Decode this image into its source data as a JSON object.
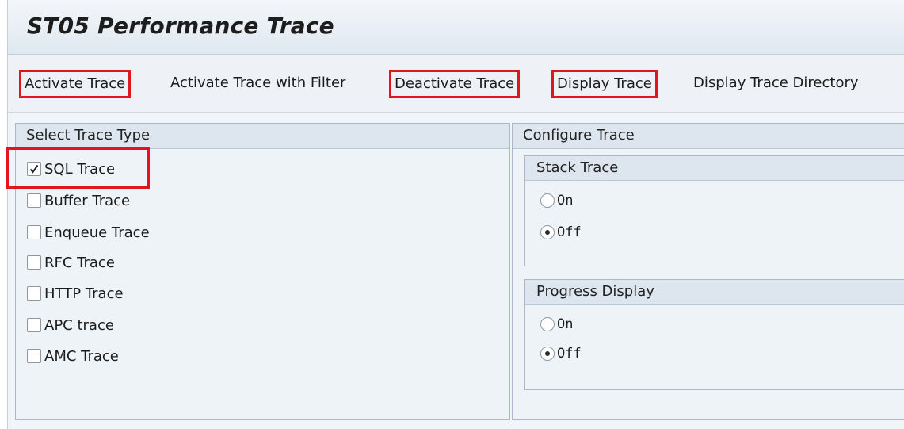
{
  "title": "ST05 Performance Trace",
  "toolbar": {
    "activate": "Activate Trace",
    "activate_filter": "Activate Trace with Filter",
    "deactivate": "Deactivate Trace",
    "display": "Display Trace",
    "display_dir": "Display Trace Directory"
  },
  "highlight_color": "#e0161e",
  "select_trace": {
    "header": "Select Trace Type",
    "items": [
      {
        "label": "SQL Trace",
        "checked": true
      },
      {
        "label": "Buffer Trace",
        "checked": false
      },
      {
        "label": "Enqueue Trace",
        "checked": false
      },
      {
        "label": "RFC Trace",
        "checked": false
      },
      {
        "label": "HTTP Trace",
        "checked": false
      },
      {
        "label": "APC trace",
        "checked": false
      },
      {
        "label": "AMC Trace",
        "checked": false
      }
    ]
  },
  "configure": {
    "header": "Configure Trace",
    "stack": {
      "header": "Stack Trace",
      "on": "On",
      "off": "Off",
      "selected": "off"
    },
    "progress": {
      "header": "Progress Display",
      "on": "On",
      "off": "Off",
      "selected": "off"
    }
  }
}
